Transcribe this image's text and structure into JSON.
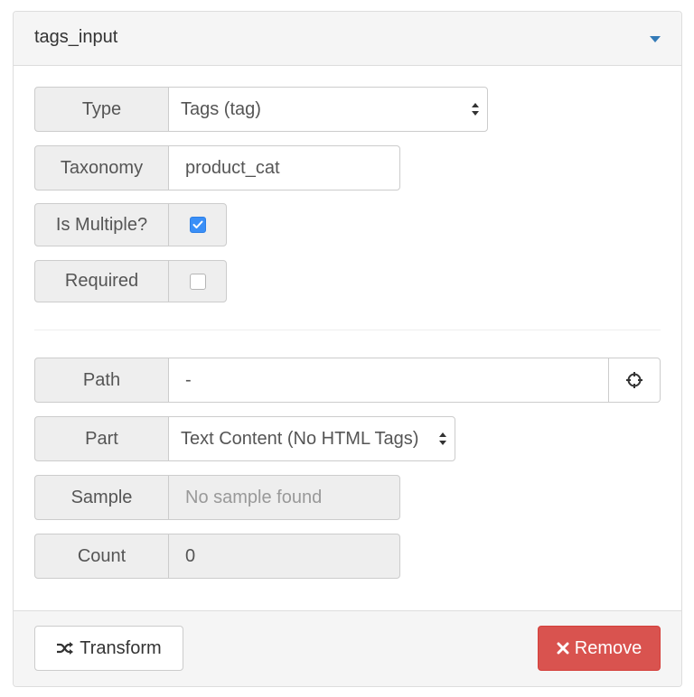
{
  "panel": {
    "title": "tags_input"
  },
  "fields": {
    "type": {
      "label": "Type",
      "value": "Tags (tag)"
    },
    "taxonomy": {
      "label": "Taxonomy",
      "value": "product_cat"
    },
    "is_multiple": {
      "label": "Is Multiple?",
      "checked": true
    },
    "required": {
      "label": "Required",
      "checked": false
    },
    "path": {
      "label": "Path",
      "value": "-"
    },
    "part": {
      "label": "Part",
      "value": "Text Content (No HTML Tags)"
    },
    "sample": {
      "label": "Sample",
      "placeholder": "No sample found"
    },
    "count": {
      "label": "Count",
      "value": "0"
    }
  },
  "footer": {
    "transform_label": "Transform",
    "remove_label": "Remove"
  },
  "colors": {
    "accent": "#337ab7",
    "checkbox_checked": "#3a8ff7",
    "danger": "#d9534f"
  },
  "icons": {
    "collapse": "caret-down-icon",
    "select": "select-arrows-icon",
    "check": "check-icon",
    "path_picker": "crosshair-icon",
    "transform": "shuffle-icon",
    "remove": "times-icon"
  }
}
